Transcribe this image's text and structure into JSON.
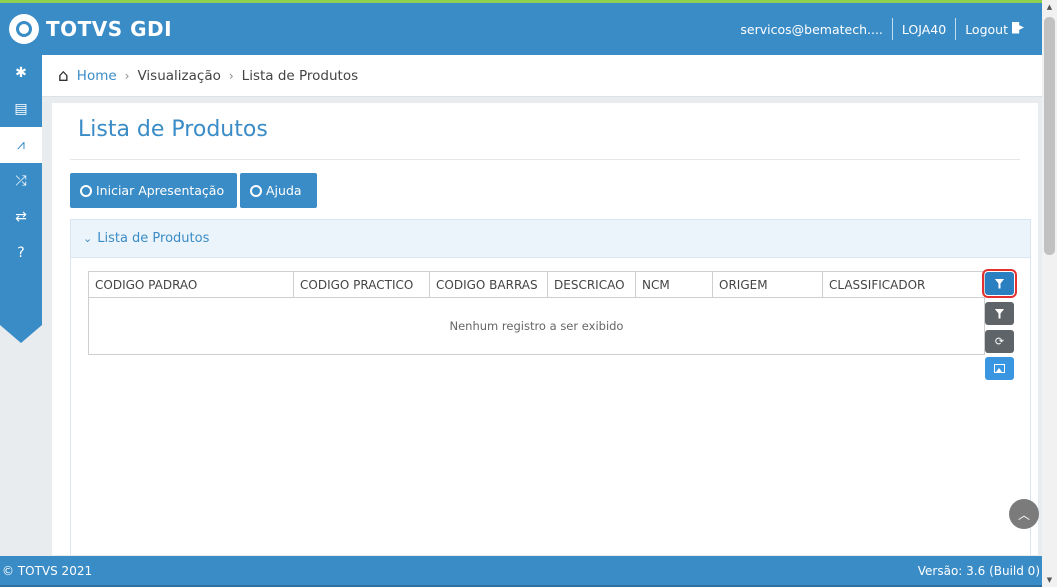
{
  "app": {
    "brand": "TOTVS GDI"
  },
  "topbar": {
    "user": "servicos@bematech....",
    "store": "LOJA40",
    "logout": "Logout"
  },
  "sidebar": {
    "items": [
      {
        "icon": "gear-icon",
        "glyph": "✱"
      },
      {
        "icon": "report-icon",
        "glyph": "▤"
      },
      {
        "icon": "chart-line-icon",
        "glyph": "⩘",
        "active": true
      },
      {
        "icon": "shuffle-icon",
        "glyph": "⤮"
      },
      {
        "icon": "retweet-icon",
        "glyph": "⇄"
      },
      {
        "icon": "help-icon",
        "glyph": "?"
      }
    ]
  },
  "breadcrumb": {
    "home": "Home",
    "sep": "›",
    "level1": "Visualização",
    "level2": "Lista de Produtos"
  },
  "page": {
    "title": "Lista de Produtos",
    "start_button": "Iniciar Apresentação",
    "help_button": "Ajuda"
  },
  "panel": {
    "title": "Lista de Produtos",
    "columns": [
      "CODIGO PADRAO",
      "CODIGO PRACTICO",
      "CODIGO BARRAS",
      "DESCRICAO",
      "NCM",
      "ORIGEM",
      "CLASSIFICADOR"
    ],
    "empty_message": "Nenhum registro a ser exibido"
  },
  "footer": {
    "copyright": "© TOTVS 2021",
    "version": "Versão: 3.6 (Build 0)"
  },
  "colors": {
    "primary": "#3a8cc7",
    "accent_top": "#8fd14f",
    "highlight": "#e53030"
  }
}
